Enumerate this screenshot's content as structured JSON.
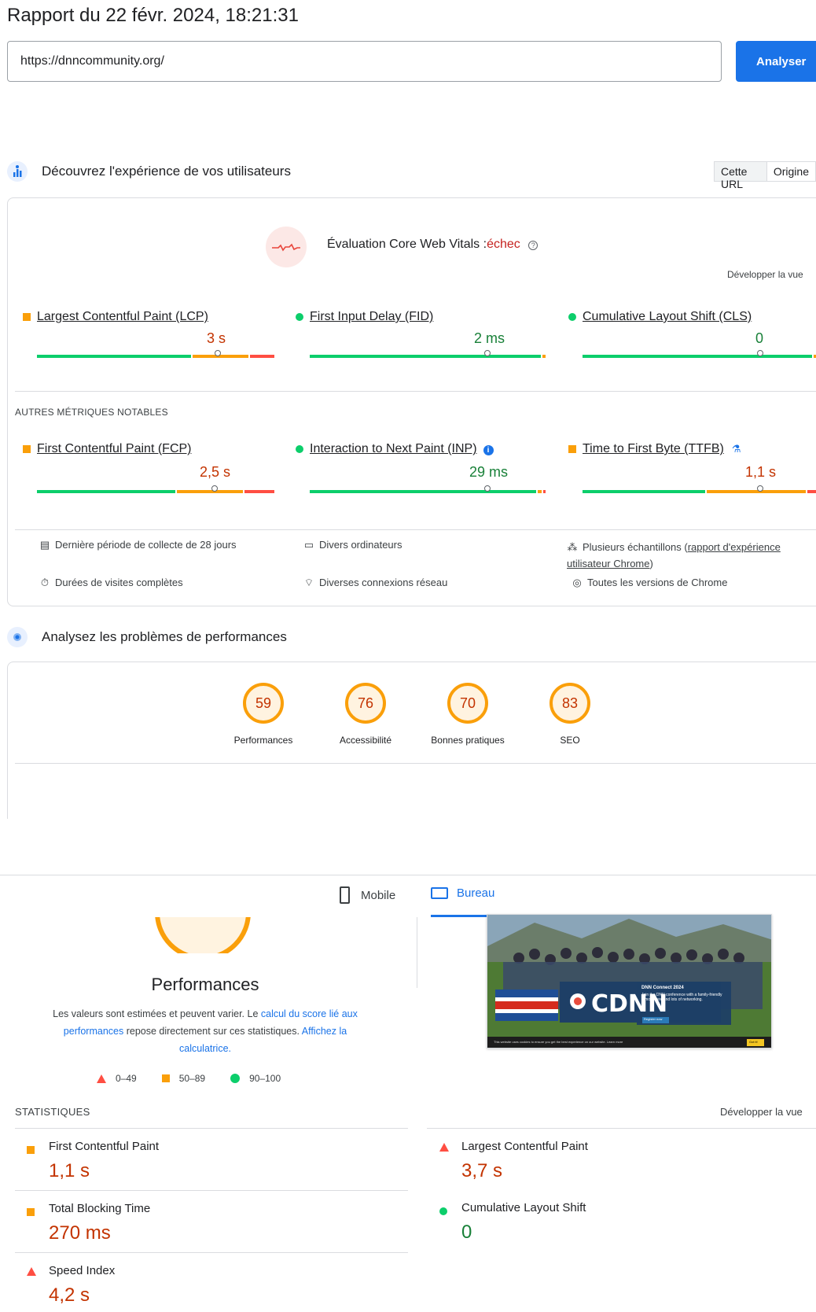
{
  "header": {
    "title": "Rapport du 22 févr. 2024, 18:21:31",
    "url_value": "https://dnncommunity.org/",
    "analyze_label": "Analyser"
  },
  "field_section": {
    "title": "Découvrez l'expérience de vos utilisateurs",
    "toggle": [
      "Cette URL",
      "Origine"
    ],
    "cwv_label": "Évaluation Core Web Vitals :",
    "cwv_status": "échec",
    "expand_label": "Développer la vue",
    "core_metrics": [
      {
        "name": "Largest Contentful Paint (LCP)",
        "value": "3 s",
        "status": "orange"
      },
      {
        "name": "First Input Delay (FID)",
        "value": "2 ms",
        "status": "green"
      },
      {
        "name": "Cumulative Layout Shift (CLS)",
        "value": "0",
        "status": "green"
      }
    ],
    "other_title": "AUTRES MÉTRIQUES NOTABLES",
    "other_metrics": [
      {
        "name": "First Contentful Paint (FCP)",
        "value": "2,5 s",
        "status": "orange"
      },
      {
        "name": "Interaction to Next Paint (INP)",
        "value": "29 ms",
        "status": "green"
      },
      {
        "name": "Time to First Byte (TTFB)",
        "value": "1,1 s",
        "status": "orange"
      }
    ],
    "info": {
      "period": "Dernière période de collecte de 28 jours",
      "devices": "Divers ordinateurs",
      "samples_prefix": "Plusieurs échantillons (",
      "samples_link": "rapport d'expérience utilisateur Chrome",
      "samples_suffix": ")",
      "durations": "Durées de visites complètes",
      "network": "Diverses connexions réseau",
      "versions": "Toutes les versions de Chrome"
    }
  },
  "lab_section": {
    "title": "Analysez les problèmes de performances",
    "scores": [
      {
        "value": "59",
        "label": "Performances"
      },
      {
        "value": "76",
        "label": "Accessibilité"
      },
      {
        "value": "70",
        "label": "Bonnes pratiques"
      },
      {
        "value": "83",
        "label": "SEO"
      }
    ]
  },
  "device_tabs": {
    "mobile": "Mobile",
    "desktop": "Bureau"
  },
  "performance": {
    "title": "Performances",
    "desc_1": "Les valeurs sont estimées et peuvent varier. Le ",
    "desc_link_1": "calcul du score lié aux performances",
    "desc_2": " repose directement sur ces statistiques. ",
    "desc_link_2": "Affichez la calculatrice.",
    "legend": [
      "0–49",
      "50–89",
      "90–100"
    ],
    "stats_title": "STATISTIQUES",
    "expand_label": "Développer la vue",
    "stats": [
      {
        "name": "First Contentful Paint",
        "value": "1,1 s",
        "status": "orange"
      },
      {
        "name": "Largest Contentful Paint",
        "value": "3,7 s",
        "status": "red"
      },
      {
        "name": "Total Blocking Time",
        "value": "270 ms",
        "status": "orange"
      },
      {
        "name": "Cumulative Layout Shift",
        "value": "0",
        "status": "green"
      },
      {
        "name": "Speed Index",
        "value": "4,2 s",
        "status": "red"
      }
    ],
    "screenshot": {
      "logo_text": "CDNN",
      "card_title": "DNN Connect 2024",
      "card_body": "Join the DNN conference with a family-friendly atmosphere and lots of networking.",
      "card_button": "Register now",
      "cookie_text": "This website uses cookies to ensure you get the best experience on our website. Learn more",
      "cookie_button": "Got it!"
    }
  }
}
